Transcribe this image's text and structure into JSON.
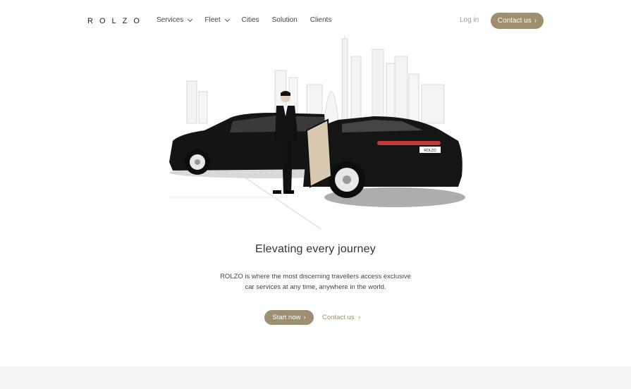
{
  "brand": {
    "logo_text": "ROLZO",
    "accent": "#9e8e72"
  },
  "nav": {
    "items": [
      {
        "label": "Services",
        "has_dropdown": true
      },
      {
        "label": "Fleet",
        "has_dropdown": true
      },
      {
        "label": "Cities",
        "has_dropdown": false
      },
      {
        "label": "Solution",
        "has_dropdown": false
      },
      {
        "label": "Clients",
        "has_dropdown": false
      }
    ],
    "login_label": "Log in",
    "contact_label": "Contact us"
  },
  "hero": {
    "headline": "Elevating every journey",
    "sub_line1": "ROLZO is where the most discerning travellers access exclusive",
    "sub_line2": "car services at any time, anywhere in the world.",
    "start_label": "Start now",
    "contact_label": "Contact us",
    "plate_text": "ROLZO"
  }
}
